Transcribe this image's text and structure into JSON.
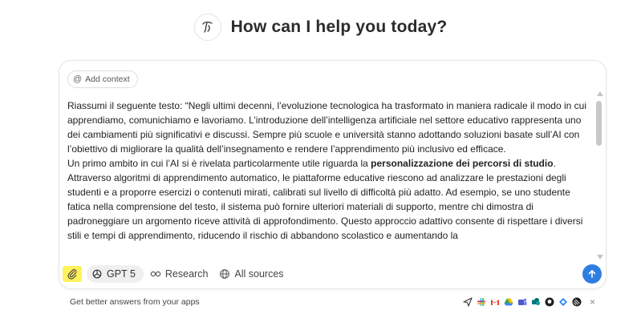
{
  "header": {
    "title": "How can I help you today?"
  },
  "composer": {
    "add_context_label": "Add context",
    "body": {
      "para1": "Riassumi il seguente testo: “Negli ultimi decenni, l’evoluzione tecnologica ha trasformato in maniera radicale il modo in cui apprendiamo, comunichiamo e lavoriamo. L’introduzione dell’intelligenza artificiale nel settore educativo rappresenta uno dei cambiamenti più significativi e discussi. Sempre più scuole e università stanno adottando soluzioni basate sull’AI con l’obiettivo di migliorare la qualità dell’insegnamento e rendere l’apprendimento più inclusivo ed efficace.",
      "para2_before": "Un primo ambito in cui l’AI si è rivelata particolarmente utile riguarda la ",
      "para2_bold": "personalizzazione dei percorsi di studio",
      "para2_after": ". Attraverso algoritmi di apprendimento automatico, le piattaforme educative riescono ad analizzare le prestazioni degli studenti e a proporre esercizi o contenuti mirati, calibrati sul livello di difficoltà più adatto. Ad esempio, se uno studente fatica nella comprensione del testo, il sistema può fornire ulteriori materiali di supporto, mentre chi dimostra di padroneggiare un argomento riceve attività di approfondimento. Questo approccio adattivo consente di rispettare i diversi stili e tempi di apprendimento, riducendo il rischio di abbandono scolastico e aumentando la"
    },
    "toolbar": {
      "model_label": "GPT 5",
      "research_label": "Research",
      "sources_label": "All sources"
    }
  },
  "apps_bar": {
    "label": "Get better answers from your apps",
    "icons": [
      "send-icon",
      "slack-icon",
      "gmail-icon",
      "google-drive-icon",
      "teams-icon",
      "sharepoint-icon",
      "github-icon",
      "jira-icon",
      "linear-icon"
    ],
    "close": "×"
  },
  "colors": {
    "accent": "#2f7de1",
    "highlight": "#fff25a"
  }
}
